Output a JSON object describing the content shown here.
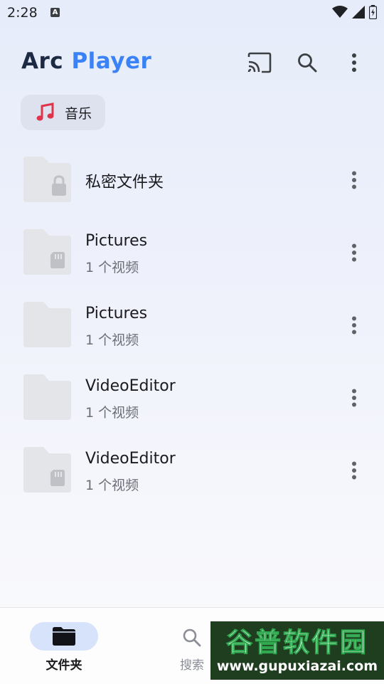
{
  "status_bar": {
    "time": "2:28",
    "notification_icon": "A"
  },
  "app_bar": {
    "logo_part1": "Arc",
    "logo_part2": "Player",
    "actions": [
      "cast-icon",
      "search-icon",
      "more-vert-icon"
    ]
  },
  "filter_chip": {
    "label": "音乐",
    "icon": "music-note-icon",
    "icon_color": "#e0344b"
  },
  "folders": [
    {
      "title": "私密文件夹",
      "subtitle": "",
      "badge": "lock"
    },
    {
      "title": "Pictures",
      "subtitle": "1 个视频",
      "badge": "sd-card"
    },
    {
      "title": "Pictures",
      "subtitle": "1 个视频",
      "badge": "none"
    },
    {
      "title": "VideoEditor",
      "subtitle": "1 个视频",
      "badge": "none"
    },
    {
      "title": "VideoEditor",
      "subtitle": "1 个视频",
      "badge": "sd-card"
    }
  ],
  "bottom_nav": {
    "items": [
      {
        "label": "文件夹",
        "icon": "folder-icon",
        "active": true
      },
      {
        "label": "搜索",
        "icon": "search-icon",
        "active": false
      }
    ]
  },
  "watermark": {
    "title": "谷普软件园",
    "url": "www.gupuxiazai.com"
  },
  "colors": {
    "accent": "#3b82f6",
    "logo_dark": "#1d2a44",
    "nav_active_pill": "#d7e3fb"
  }
}
